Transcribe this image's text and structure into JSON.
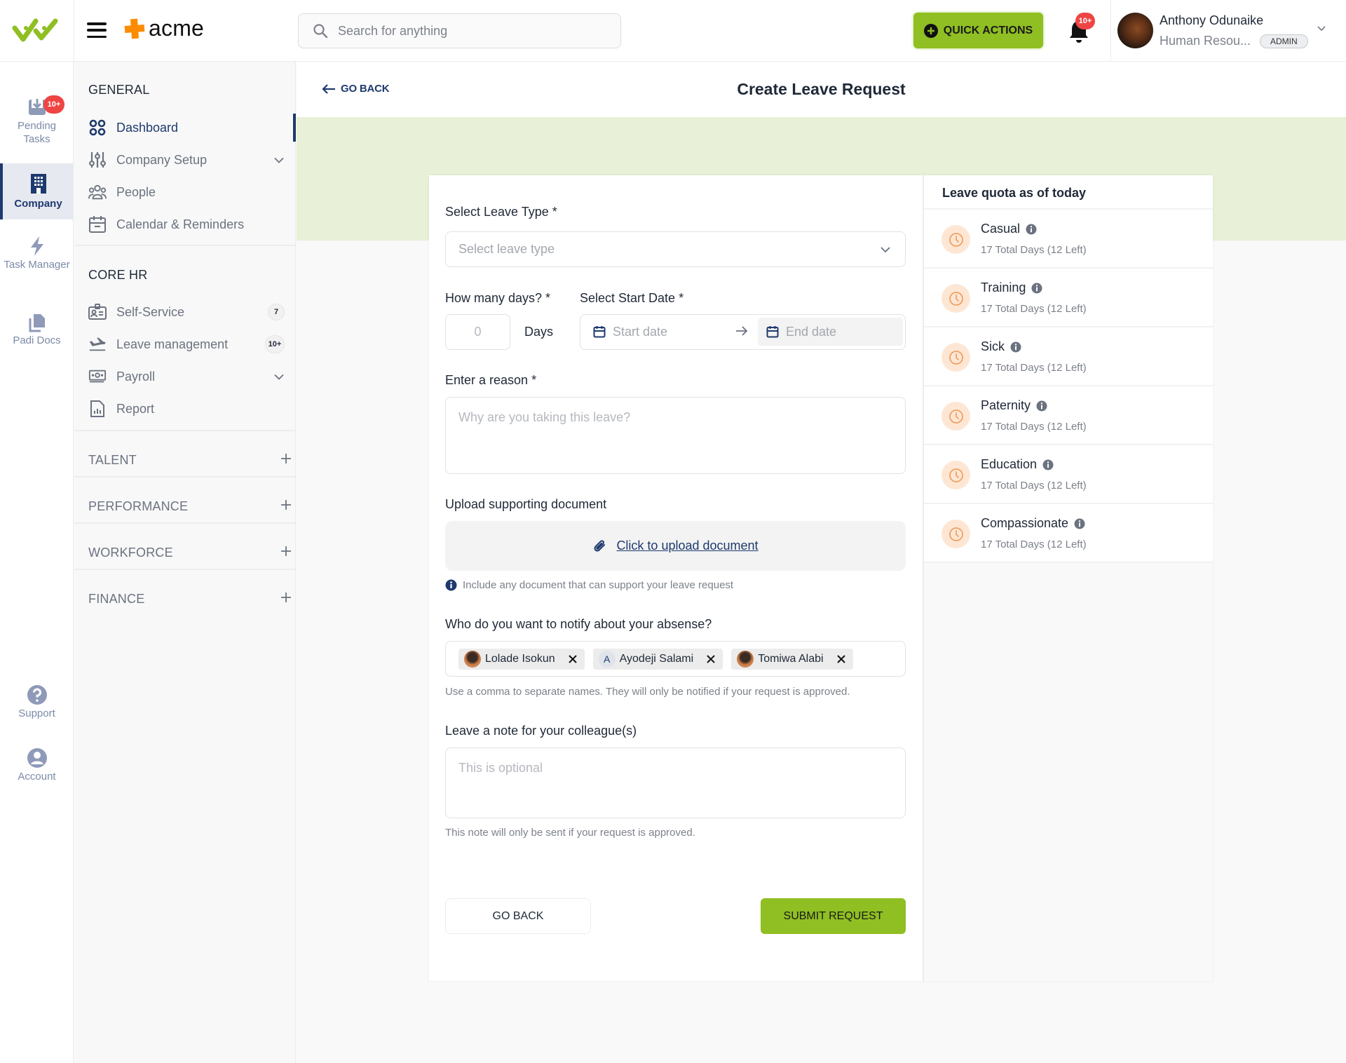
{
  "header": {
    "brand_name": "acme",
    "search_placeholder": "Search for anything",
    "quick_actions_label": "QUICK ACTIONS",
    "notifications_badge": "10+",
    "user": {
      "name": "Anthony Odunaike",
      "role": "Human Resou...",
      "badge": "ADMIN"
    }
  },
  "rail": {
    "items": [
      {
        "label": "Pending Tasks",
        "badge": "10+"
      },
      {
        "label": "Company"
      },
      {
        "label": "Task Manager"
      },
      {
        "label": "Padi Docs"
      },
      {
        "label": "Support"
      },
      {
        "label": "Account"
      }
    ]
  },
  "nav": {
    "general_title": "GENERAL",
    "general_items": [
      {
        "label": "Dashboard"
      },
      {
        "label": "Company Setup"
      },
      {
        "label": "People"
      },
      {
        "label": "Calendar & Reminders"
      }
    ],
    "core_title": "CORE HR",
    "core_items": [
      {
        "label": "Self-Service",
        "count": "7"
      },
      {
        "label": "Leave management",
        "count": "10+"
      },
      {
        "label": "Payroll"
      },
      {
        "label": "Report"
      }
    ],
    "groups": [
      {
        "label": "TALENT"
      },
      {
        "label": "PERFORMANCE"
      },
      {
        "label": "WORKFORCE"
      },
      {
        "label": "FINANCE"
      }
    ]
  },
  "page": {
    "go_back_label": "GO BACK",
    "title": "Create Leave Request"
  },
  "form": {
    "leave_type_label": "Select Leave Type *",
    "leave_type_placeholder": "Select leave type",
    "days_label": "How many days? *",
    "days_placeholder": "0",
    "days_unit": "Days",
    "start_date_label": "Select Start Date *",
    "start_date_placeholder": "Start date",
    "end_date_placeholder": "End date",
    "reason_label": "Enter a reason *",
    "reason_placeholder": "Why are you taking this leave?",
    "upload_label": "Upload supporting document",
    "upload_link": "Click to upload document",
    "upload_hint": "Include any document that can support your leave request",
    "notify_label": "Who do you want to notify about your absense?",
    "notify_chips": [
      {
        "name": "Lolade Isokun",
        "avatar": "photo"
      },
      {
        "name": "Ayodeji Salami",
        "avatar": "A"
      },
      {
        "name": "Tomiwa Alabi",
        "avatar": "photo"
      }
    ],
    "notify_hint": "Use a comma to separate names. They will only be notified if your request is approved.",
    "note_label": "Leave a note for your colleague(s)",
    "note_placeholder": "This is optional",
    "note_hint": "This note will only be sent if your request is approved.",
    "go_back_button": "GO BACK",
    "submit_button": "SUBMIT REQUEST"
  },
  "quota": {
    "title": "Leave quota as of today",
    "items": [
      {
        "name": "Casual",
        "detail": "17 Total Days (12 Left)"
      },
      {
        "name": "Training",
        "detail": "17 Total Days (12 Left)"
      },
      {
        "name": "Sick",
        "detail": "17 Total Days (12 Left)"
      },
      {
        "name": "Paternity",
        "detail": "17 Total Days (12 Left)"
      },
      {
        "name": "Education",
        "detail": "17 Total Days (12 Left)"
      },
      {
        "name": "Compassionate",
        "detail": "17 Total Days (12 Left)"
      }
    ]
  },
  "colors": {
    "accent_green": "#8fbf22",
    "navy": "#1e3a6e",
    "badge_red": "#ef4444",
    "band_green": "#e8f0d8",
    "quota_icon_bg": "#fde7d4",
    "quota_icon": "#f0a064"
  }
}
